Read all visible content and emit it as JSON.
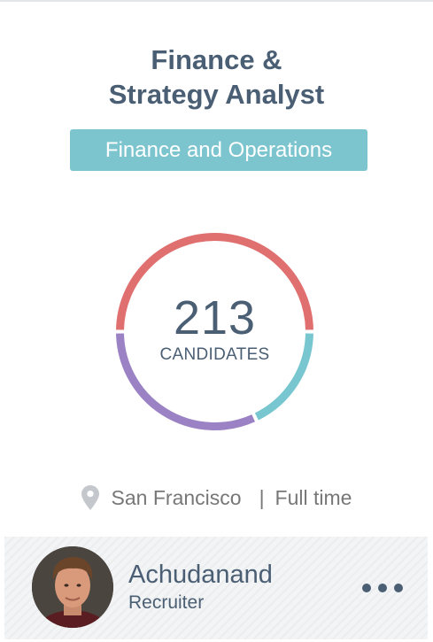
{
  "job": {
    "title_line1": "Finance &",
    "title_line2": "Strategy Analyst",
    "department": "Finance and Operations"
  },
  "candidates": {
    "count": "213",
    "label": "CANDIDATES",
    "ring_segments": [
      {
        "color": "#e0706f",
        "fraction": 0.5
      },
      {
        "color": "#78c6cf",
        "fraction": 0.18
      },
      {
        "color": "#9b82c4",
        "fraction": 0.32
      }
    ]
  },
  "details": {
    "location_icon": "map-pin-icon",
    "location": "San Francisco",
    "separator": "|",
    "employment_type": "Full time"
  },
  "owner": {
    "name": "Achudanand",
    "role": "Recruiter",
    "avatar_icon": "user-photo",
    "more_icon": "more-dots-icon"
  },
  "colors": {
    "title_text": "#4a5e74",
    "badge_bg": "#7cc5cf",
    "meta_text": "#777777",
    "footer_bg": "#f3f4f5"
  }
}
